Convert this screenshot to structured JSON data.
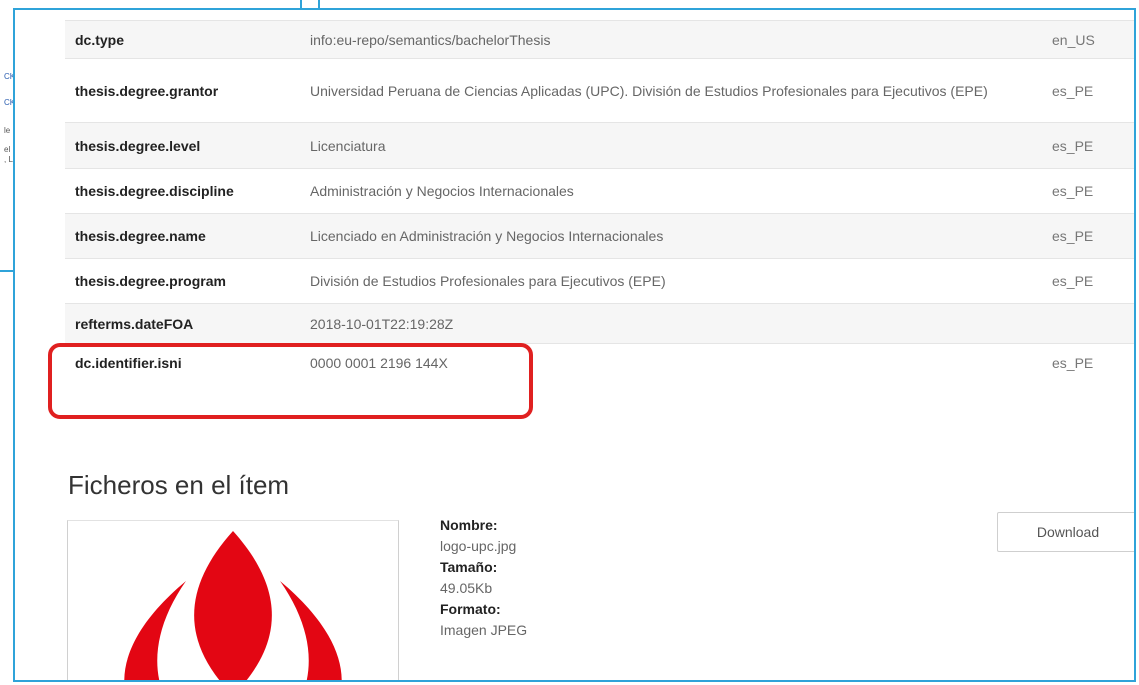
{
  "metadata": {
    "rows": [
      {
        "key": "dc.type",
        "value": "info:eu-repo/semantics/bachelorThesis",
        "lang": "en_US"
      },
      {
        "key": "thesis.degree.grantor",
        "value": "Universidad Peruana de Ciencias Aplicadas (UPC). División de Estudios Profesionales para Ejecutivos (EPE)",
        "lang": "es_PE"
      },
      {
        "key": "thesis.degree.level",
        "value": "Licenciatura",
        "lang": "es_PE"
      },
      {
        "key": "thesis.degree.discipline",
        "value": "Administración y Negocios Internacionales",
        "lang": "es_PE"
      },
      {
        "key": "thesis.degree.name",
        "value": "Licenciado en Administración y Negocios Internacionales",
        "lang": "es_PE"
      },
      {
        "key": "thesis.degree.program",
        "value": "División de Estudios Profesionales para Ejecutivos (EPE)",
        "lang": "es_PE"
      },
      {
        "key": "refterms.dateFOA",
        "value": "2018-10-01T22:19:28Z",
        "lang": ""
      },
      {
        "key": "dc.identifier.isni",
        "value": "0000 0001 2196 144X",
        "lang": "es_PE"
      }
    ]
  },
  "files": {
    "section_title": "Ficheros en el ítem",
    "name_label": "Nombre:",
    "name_value": "logo-upc.jpg",
    "size_label": "Tamaño:",
    "size_value": "49.05Kb",
    "format_label": "Formato:",
    "format_value": "Imagen JPEG",
    "download_label": "Download"
  },
  "colors": {
    "window_border": "#2fa3d9",
    "highlight": "#e02020",
    "logo_red": "#e30613"
  },
  "background_fragments": [
    "CK",
    "CK",
    "le",
    "el",
    ", L"
  ]
}
